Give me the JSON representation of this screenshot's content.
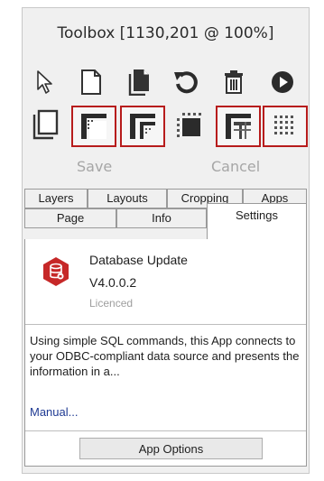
{
  "title": "Toolbox [1130,201 @ 100%]",
  "toolbar_row1": [
    {
      "name": "select-pointer-icon"
    },
    {
      "name": "new-page-icon"
    },
    {
      "name": "copy-page-icon"
    },
    {
      "name": "undo-icon"
    },
    {
      "name": "delete-icon"
    },
    {
      "name": "play-icon"
    }
  ],
  "toolbar_row2": [
    {
      "name": "page-frame-icon",
      "highlighted": false
    },
    {
      "name": "layout-top-left-icon",
      "highlighted": true
    },
    {
      "name": "layout-split-icon",
      "highlighted": true
    },
    {
      "name": "layout-dashed-icon",
      "highlighted": false
    },
    {
      "name": "layout-grid-icon",
      "highlighted": true
    },
    {
      "name": "layout-dots-icon",
      "highlighted": true
    }
  ],
  "save_label": "Save",
  "cancel_label": "Cancel",
  "tabs_back": [
    "Layers",
    "Layouts",
    "Cropping",
    "Apps"
  ],
  "tabs_front": [
    "Page",
    "Info",
    "Settings"
  ],
  "active_tab": "Settings",
  "app": {
    "name": "Database Update",
    "version": "V4.0.0.2",
    "license": "Licenced",
    "description": "Using simple SQL commands, this App connects to your ODBC-compliant data source and presents the information in a...",
    "manual_link": "Manual...",
    "options_button": "App Options"
  },
  "colors": {
    "highlight": "#b71c1c",
    "app_icon": "#c62828",
    "link": "#1f3a93"
  }
}
